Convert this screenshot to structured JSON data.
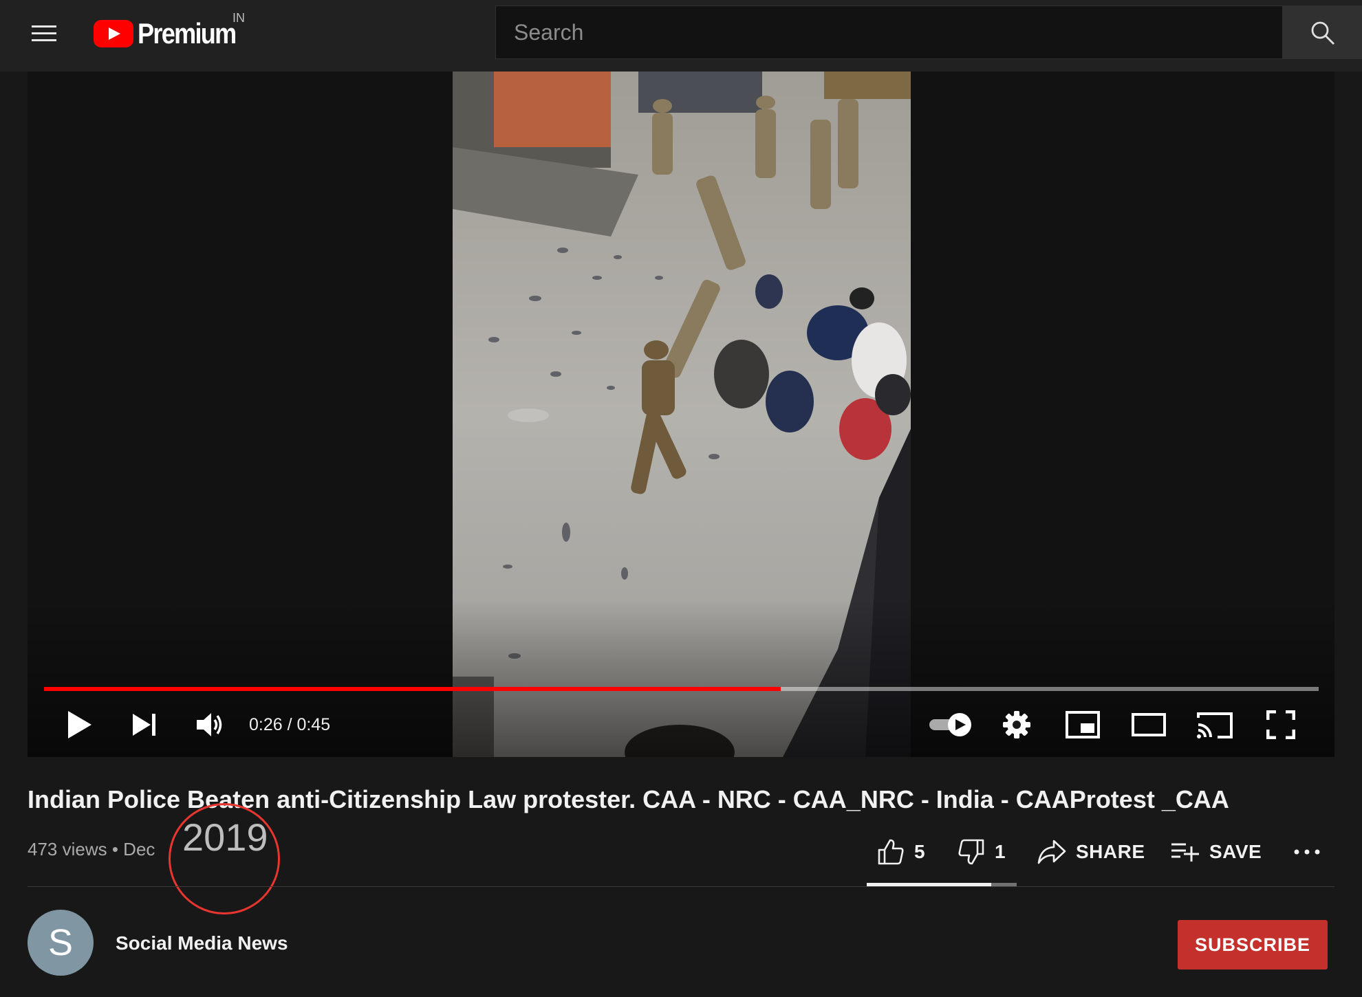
{
  "header": {
    "logo_text": "Premium",
    "region": "IN",
    "search_placeholder": "Search"
  },
  "player": {
    "current_time": "0:26",
    "duration": "0:45",
    "time_display": "0:26 / 0:45",
    "progress_fraction": 0.578,
    "autoplay_on": true
  },
  "video": {
    "title": "Indian Police Beaten anti-Citizenship Law protester. CAA - NRC - CAA_NRC - India - CAAProtest _CAA",
    "views": "473 views",
    "separator": "•",
    "date_partial": "Dec",
    "meta_text": "473 views • Dec",
    "year_annotation": "2019",
    "likes": "5",
    "dislikes": "1",
    "like_fraction": 0.83,
    "share_label": "SHARE",
    "save_label": "SAVE"
  },
  "channel": {
    "avatar_letter": "S",
    "name": "Social Media News",
    "subscribe_label": "SUBSCRIBE"
  },
  "colors": {
    "accent_red": "#ff0000",
    "subscribe_red": "#c4302b",
    "annotation_circle": "#e7362f",
    "background": "#181818",
    "topbar": "#212121"
  }
}
